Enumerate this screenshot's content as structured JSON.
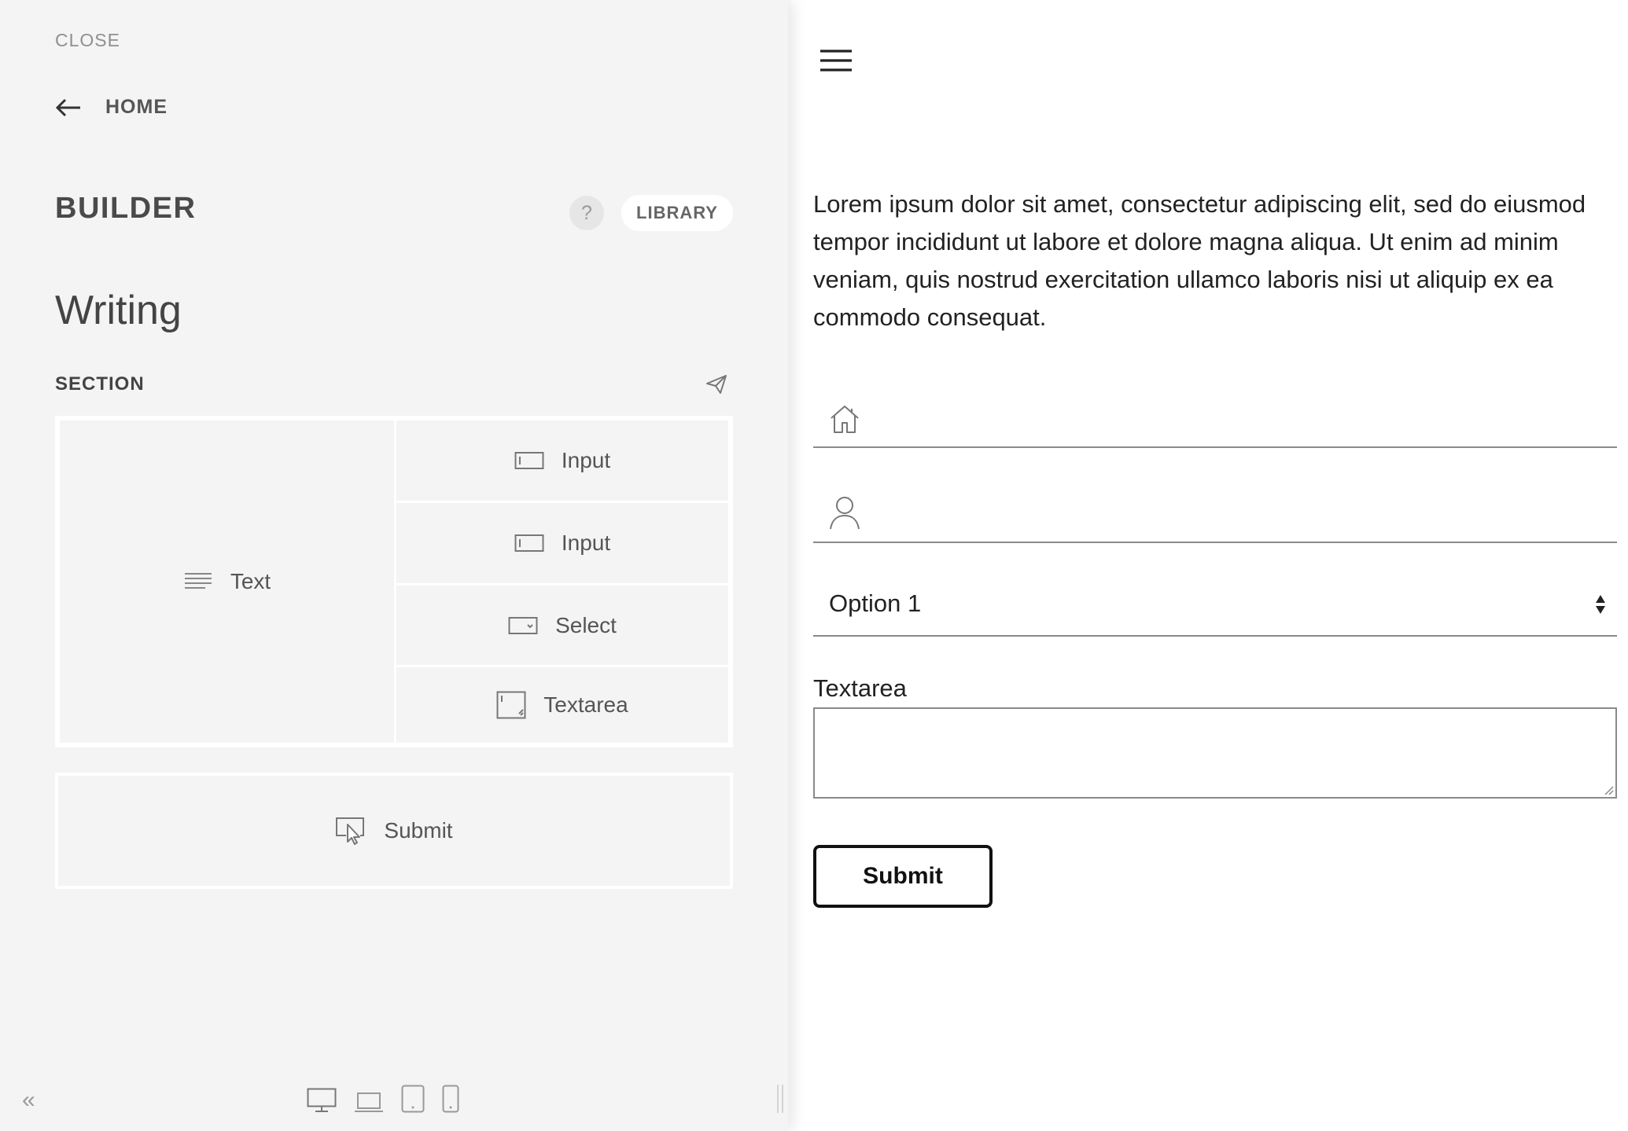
{
  "sidebar": {
    "close_label": "CLOSE",
    "home_label": "HOME",
    "title": "BUILDER",
    "help_label": "?",
    "library_label": "LIBRARY",
    "page_name": "Writing",
    "section_label": "SECTION",
    "elements": {
      "text_label": "Text",
      "input1_label": "Input",
      "input2_label": "Input",
      "select_label": "Select",
      "textarea_label": "Textarea",
      "submit_label": "Submit"
    },
    "collapse_label": "«"
  },
  "preview": {
    "paragraph": "Lorem ipsum dolor sit amet, consectetur adipiscing elit, sed do eiusmod tempor incididunt ut labore et dolore magna aliqua. Ut enim ad minim veniam, quis nostrud exercitation ullamco laboris nisi ut aliquip ex ea commodo consequat.",
    "select_value": "Option 1",
    "textarea_label": "Textarea",
    "submit_label": "Submit"
  }
}
